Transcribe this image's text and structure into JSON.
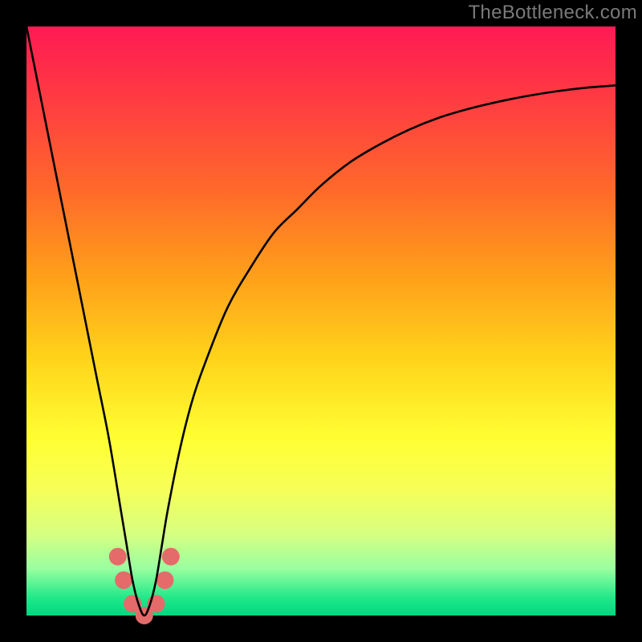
{
  "watermark": "TheBottleneck.com",
  "chart_data": {
    "type": "line",
    "title": "",
    "xlabel": "",
    "ylabel": "",
    "xlim": [
      0,
      100
    ],
    "ylim": [
      0,
      100
    ],
    "series": [
      {
        "name": "bottleneck-curve",
        "x": [
          0,
          2,
          4,
          6,
          8,
          10,
          12,
          14,
          16,
          17,
          18,
          19,
          20,
          21,
          22,
          23,
          24,
          26,
          28,
          30,
          34,
          38,
          42,
          46,
          50,
          55,
          60,
          65,
          70,
          75,
          80,
          85,
          90,
          95,
          100
        ],
        "values": [
          100,
          90,
          80,
          70,
          60,
          50,
          40,
          30,
          18,
          12,
          6,
          2,
          0,
          2,
          6,
          12,
          18,
          28,
          36,
          42,
          52,
          59,
          65,
          69,
          73,
          77,
          80,
          82.5,
          84.5,
          86,
          87.2,
          88.2,
          89,
          89.6,
          90
        ]
      }
    ],
    "markers": {
      "name": "highlight-dots",
      "color": "#e56b6b",
      "x": [
        15.5,
        16.5,
        18,
        20,
        22,
        23.5,
        24.5
      ],
      "values": [
        10,
        6,
        2,
        0,
        2,
        6,
        10
      ]
    }
  },
  "colors": {
    "curve": "#000000",
    "marker": "#e56b6b"
  }
}
